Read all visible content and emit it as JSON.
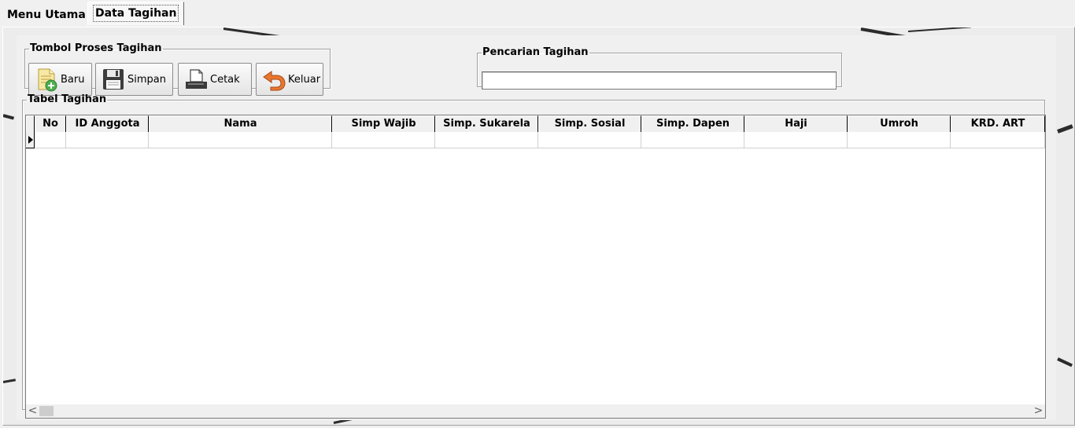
{
  "tabs": [
    {
      "label": "Menu Utama",
      "active": false
    },
    {
      "label": "Data Tagihan",
      "active": true
    }
  ],
  "tombol_group": {
    "legend": "Tombol Proses Tagihan",
    "buttons": [
      {
        "label": "Baru",
        "icon": "new-document-icon"
      },
      {
        "label": "Simpan",
        "icon": "floppy-disk-icon"
      },
      {
        "label": "Cetak",
        "icon": "printer-icon"
      },
      {
        "label": "Keluar",
        "icon": "exit-arrow-icon"
      }
    ]
  },
  "search_group": {
    "legend": "Pencarian Tagihan",
    "value": ""
  },
  "table_group": {
    "legend": "Tabel Tagihan",
    "columns": [
      "No",
      "ID Anggota",
      "Nama",
      "Simp Wajib",
      "Simp. Sukarela",
      "Simp. Sosial",
      "Simp. Dapen",
      "Haji",
      "Umroh",
      "KRD. ART"
    ],
    "rows": [
      [
        "",
        "",
        "",
        "",
        "",
        "",
        "",
        "",
        "",
        ""
      ]
    ]
  },
  "scrollbar": {
    "left": "<",
    "right": ">"
  },
  "colors": {
    "background": "#f0f0f0",
    "grid_line": "#000000",
    "icon_orange": "#e8772e",
    "icon_green": "#4caf50"
  }
}
